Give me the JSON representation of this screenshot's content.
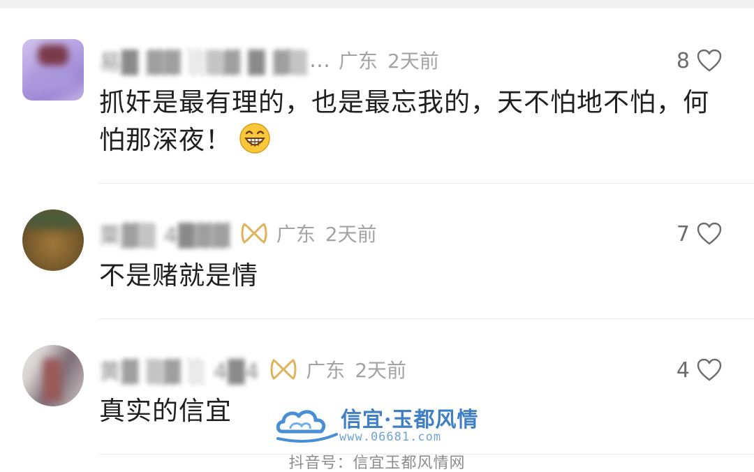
{
  "comments": [
    {
      "name_visible": "易",
      "name_suffix": "…",
      "location": "广东",
      "time": "2天前",
      "likes": "8",
      "text": "抓奸是最有理的，也是最忘我的，天不怕地不怕，何怕那深夜！",
      "has_fan_badge": false,
      "emoji": "grinning-face-icon"
    },
    {
      "name_visible": "粟",
      "name_suffix": "",
      "location": "广东",
      "time": "2天前",
      "likes": "7",
      "text": "不是赌就是情",
      "has_fan_badge": true
    },
    {
      "name_visible": "黄",
      "name_suffix": "",
      "location": "广东",
      "time": "2天前",
      "likes": "4",
      "text": "真实的信宜",
      "has_fan_badge": true
    }
  ],
  "watermark": {
    "title": "信宜·玉都风情",
    "url": "www.06681.com",
    "douyin": "抖音号：信宜玉都风情网"
  },
  "colors": {
    "text": "#1f1f1f",
    "meta": "#a3a3a3",
    "badge": "#e0b25c",
    "watermark_blue": "#3f7fc6"
  }
}
